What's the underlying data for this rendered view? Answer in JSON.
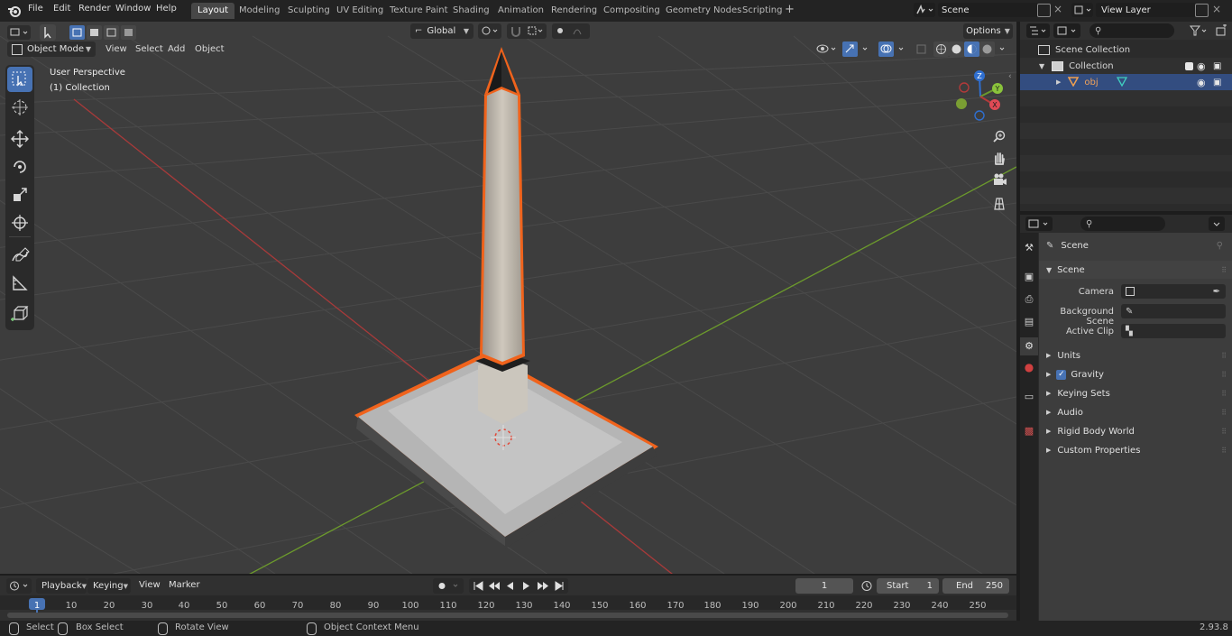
{
  "menus": [
    "File",
    "Edit",
    "Render",
    "Window",
    "Help"
  ],
  "workspaces": [
    "Layout",
    "Modeling",
    "Sculpting",
    "UV Editing",
    "Texture Paint",
    "Shading",
    "Animation",
    "Rendering",
    "Compositing",
    "Geometry Nodes",
    "Scripting"
  ],
  "active_workspace": "Layout",
  "scene_field": "Scene",
  "view_layer_field": "View Layer",
  "viewport_header": {
    "mode": "Object Mode",
    "menus": [
      "View",
      "Select",
      "Add",
      "Object"
    ],
    "transform_orientation": "Global",
    "options_label": "Options"
  },
  "overlay_text": {
    "line1": "User Perspective",
    "line2": "(1) Collection"
  },
  "gizmo_axes": [
    "Z",
    "Y",
    "X"
  ],
  "outliner": {
    "scene_collection": "Scene Collection",
    "collection": "Collection",
    "object": "obj"
  },
  "properties": {
    "context": "Scene",
    "panel_title": "Scene",
    "camera_label": "Camera",
    "background_scene_label": "Background Scene",
    "active_clip_label": "Active Clip",
    "panels": [
      "Units",
      "Gravity",
      "Keying Sets",
      "Audio",
      "Rigid Body World",
      "Custom Properties"
    ],
    "gravity_checked": true
  },
  "timeline": {
    "menus": [
      "Playback",
      "Keying",
      "View",
      "Marker"
    ],
    "current_frame": "1",
    "start_label": "Start",
    "start_value": "1",
    "end_label": "End",
    "end_value": "250",
    "ruler": [
      "1",
      "10",
      "20",
      "30",
      "40",
      "50",
      "60",
      "70",
      "80",
      "90",
      "100",
      "110",
      "120",
      "130",
      "140",
      "150",
      "160",
      "170",
      "180",
      "190",
      "200",
      "210",
      "220",
      "230",
      "240",
      "250"
    ]
  },
  "statusbar": {
    "select": "Select",
    "box_select": "Box Select",
    "rotate_view": "Rotate View",
    "context_menu": "Object Context Menu",
    "version": "2.93.8"
  },
  "colors": {
    "accent": "#4772b3",
    "selection_outline": "#f2691e",
    "x_axis": "#b33a3a",
    "y_axis": "#6b9a2d",
    "z_axis": "#2f6fd0"
  }
}
